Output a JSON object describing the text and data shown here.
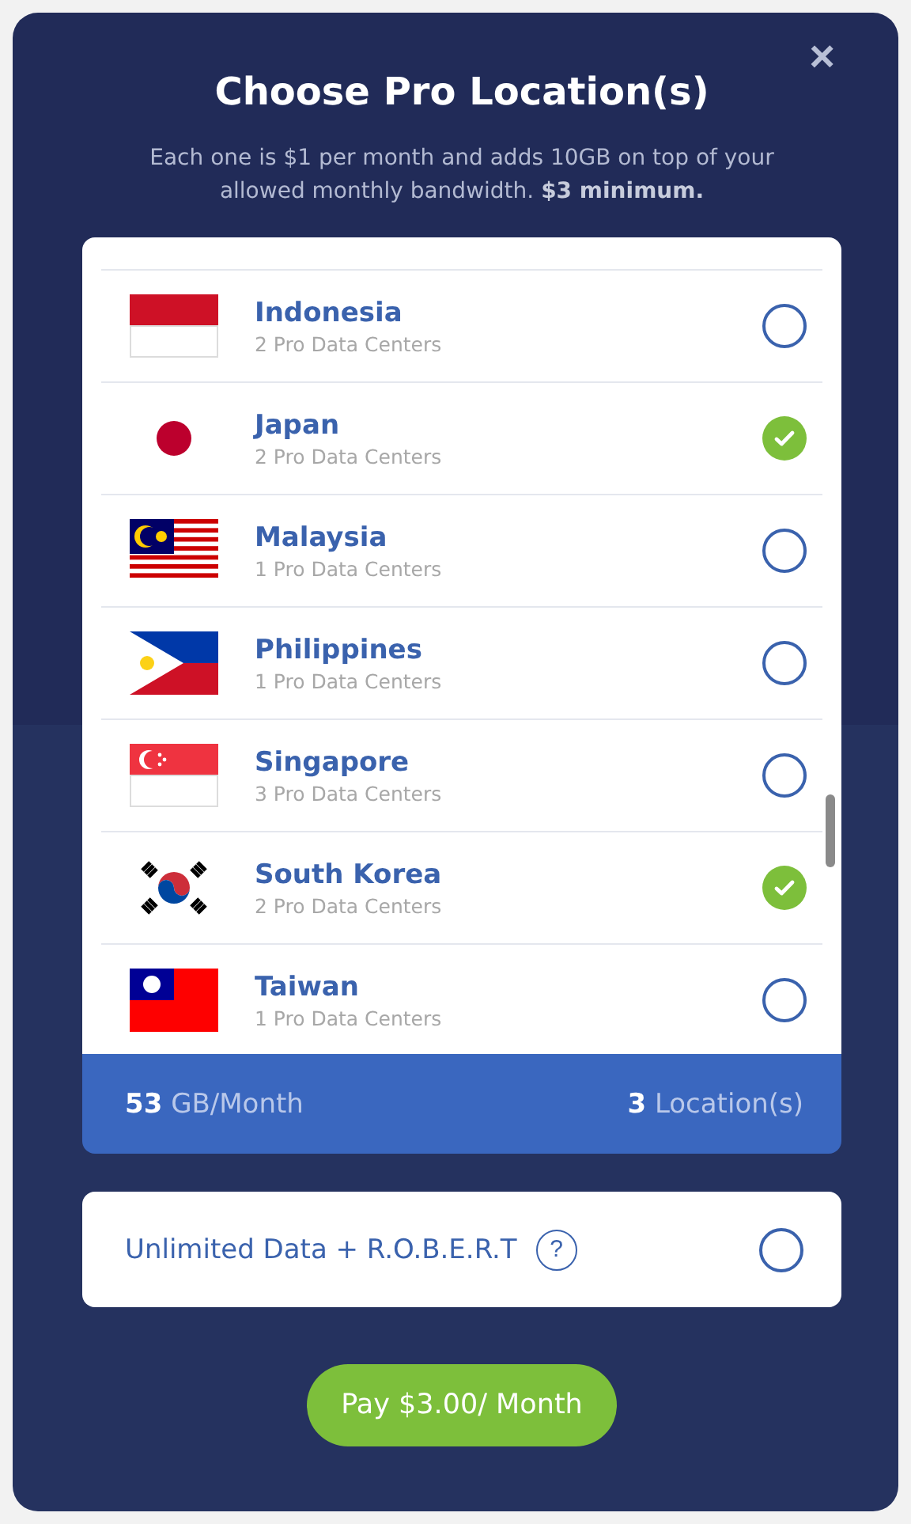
{
  "modal": {
    "title": "Choose Pro Location(s)",
    "close": "×",
    "subtitle": "Each one is $1 per month and adds 10GB on top of your allowed monthly bandwidth. **$3 minimum.**"
  },
  "locations": [
    {
      "kind": "indonesia",
      "name": "Indonesia",
      "centers": "2 Pro Data Centers",
      "selected": false
    },
    {
      "kind": "japan",
      "name": "Japan",
      "centers": "2 Pro Data Centers",
      "selected": true
    },
    {
      "kind": "malaysia",
      "name": "Malaysia",
      "centers": "1 Pro Data Centers",
      "selected": false
    },
    {
      "kind": "philippines",
      "name": "Philippines",
      "centers": "1 Pro Data Centers",
      "selected": false
    },
    {
      "kind": "singapore",
      "name": "Singapore",
      "centers": "3 Pro Data Centers",
      "selected": false
    },
    {
      "kind": "korea",
      "name": "South Korea",
      "centers": "2 Pro Data Centers",
      "selected": true
    },
    {
      "kind": "taiwan",
      "name": "Taiwan",
      "centers": "1 Pro Data Centers",
      "selected": false
    }
  ],
  "summary": {
    "amount": "53",
    "amount_unit": "GB/Month",
    "count": "3",
    "count_unit": "Location(s)"
  },
  "option": {
    "label": "Unlimited Data + R.O.B.E.R.T",
    "help": "?",
    "checked": false
  },
  "pay_button": "Pay $3.00/ Month"
}
